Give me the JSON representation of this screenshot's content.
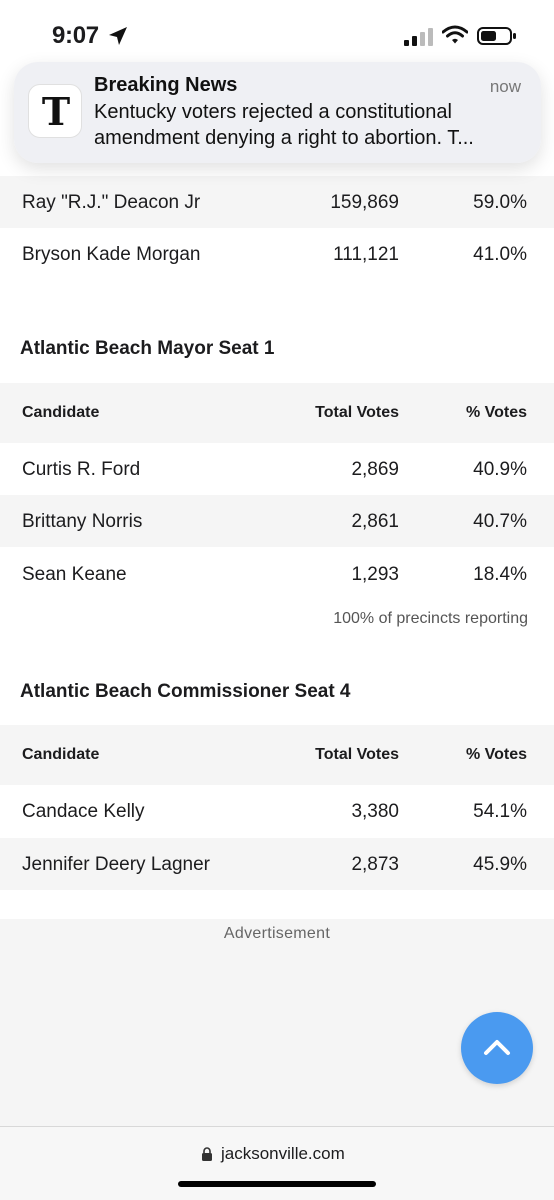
{
  "status_bar": {
    "time": "9:07"
  },
  "notification": {
    "app_icon_letter": "T",
    "title": "Breaking News",
    "time": "now",
    "body": "Kentucky voters rejected a constitutional amendment denying a right to abortion. T..."
  },
  "race0": {
    "rows": [
      {
        "name": "Ray \"R.J.\" Deacon Jr",
        "votes": "159,869",
        "pct": "59.0%"
      },
      {
        "name": "Bryson Kade Morgan",
        "votes": "111,121",
        "pct": "41.0%"
      }
    ]
  },
  "race1": {
    "title": "Atlantic Beach Mayor Seat 1",
    "headers": {
      "candidate": "Candidate",
      "votes": "Total Votes",
      "pct": "% Votes"
    },
    "rows": [
      {
        "name": "Curtis R. Ford",
        "votes": "2,869",
        "pct": "40.9%"
      },
      {
        "name": "Brittany Norris",
        "votes": "2,861",
        "pct": "40.7%"
      },
      {
        "name": "Sean Keane",
        "votes": "1,293",
        "pct": "18.4%"
      }
    ],
    "reporting": "100% of precincts reporting"
  },
  "race2": {
    "title": "Atlantic Beach Commissioner Seat 4",
    "headers": {
      "candidate": "Candidate",
      "votes": "Total Votes",
      "pct": "% Votes"
    },
    "rows": [
      {
        "name": "Candace Kelly",
        "votes": "3,380",
        "pct": "54.1%"
      },
      {
        "name": "Jennifer Deery Lagner",
        "votes": "2,873",
        "pct": "45.9%"
      }
    ]
  },
  "advertisement_label": "Advertisement",
  "url_bar": {
    "domain": "jacksonville.com"
  },
  "colors": {
    "accent": "#4a9af0",
    "row_alt": "#f5f5f5"
  },
  "icons": {
    "location": "location-arrow-icon",
    "signal": "cellular-signal-icon",
    "wifi": "wifi-icon",
    "battery": "battery-icon",
    "scroll_top": "chevron-up-icon",
    "lock": "lock-icon"
  }
}
